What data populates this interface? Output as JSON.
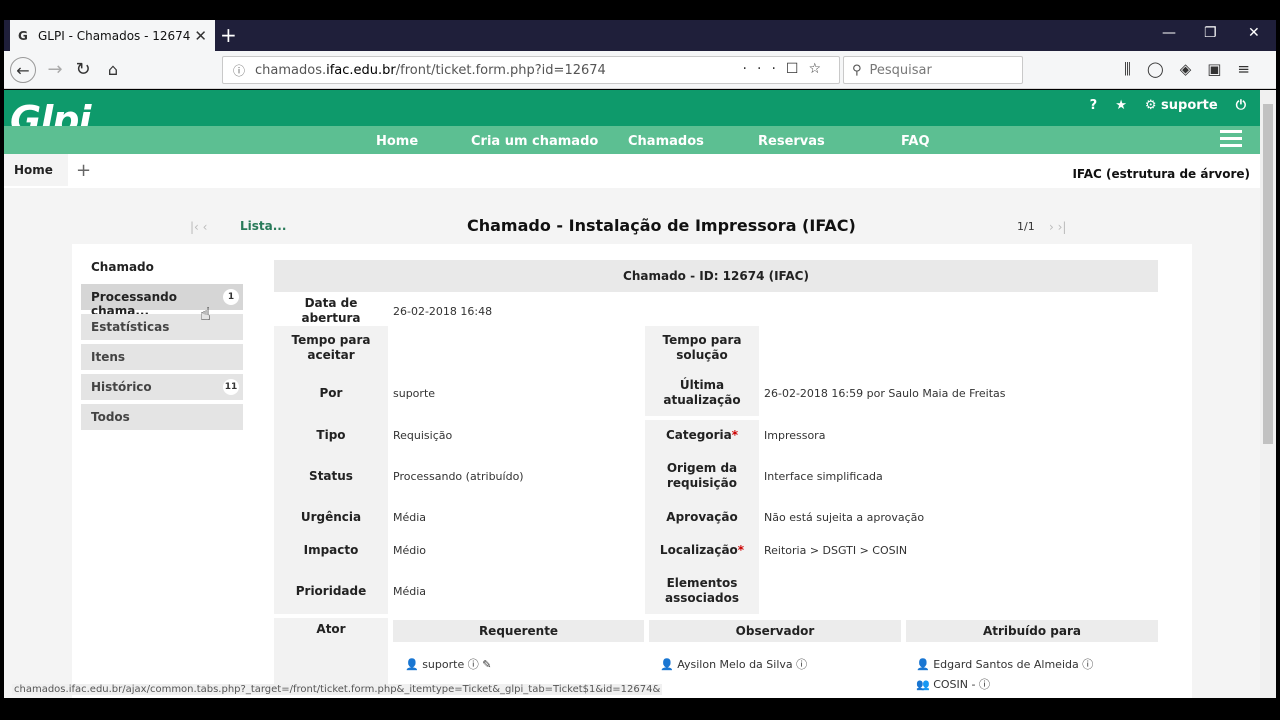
{
  "browser": {
    "tab_title": "GLPI - Chamados - 12674",
    "tab_favicon": "G",
    "url_prefix": "chamados.",
    "url_domain": "ifac.edu.br",
    "url_path": "/front/ticket.form.php?id=12674",
    "search_placeholder": "Pesquisar",
    "status_url": "chamados.ifac.edu.br/ajax/common.tabs.php?_target=/front/ticket.form.php&_itemtype=Ticket&_glpi_tab=Ticket$1&id=12674&"
  },
  "glpi": {
    "logo": "Glpi",
    "user": "suporte",
    "help": "?",
    "menu": [
      "Home",
      "Cria um chamado",
      "Chamados",
      "Reservas",
      "FAQ"
    ],
    "breadcrumb_home": "Home",
    "breadcrumb_plus": "+",
    "entity": "IFAC (estrutura de árvore)"
  },
  "page": {
    "list_link": "Lista...",
    "title": "Chamado - Instalação de Impressora (IFAC)",
    "counter": "1/1"
  },
  "sidebar": {
    "heading": "Chamado",
    "items": [
      {
        "label": "Processando chama...",
        "badge": "1"
      },
      {
        "label": "Estatísticas",
        "badge": ""
      },
      {
        "label": "Itens",
        "badge": ""
      },
      {
        "label": "Histórico",
        "badge": "11"
      },
      {
        "label": "Todos",
        "badge": ""
      }
    ]
  },
  "ticket": {
    "header": "Chamado - ID: 12674 (IFAC)",
    "fields": {
      "data_abertura_label": "Data de abertura",
      "data_abertura_value": "26-02-2018 16:48",
      "tempo_aceitar_label": "Tempo para aceitar",
      "tempo_solucao_label": "Tempo para solução",
      "por_label": "Por",
      "por_value": "suporte",
      "ultima_atualizacao_label": "Última atualização",
      "ultima_atualizacao_value": "26-02-2018 16:59 por Saulo Maia de Freitas",
      "tipo_label": "Tipo",
      "tipo_value": "Requisição",
      "categoria_label": "Categoria",
      "categoria_value": "Impressora",
      "status_label": "Status",
      "status_value": "Processando (atribuído)",
      "origem_label": "Origem da requisição",
      "origem_value": "Interface simplificada",
      "urgencia_label": "Urgência",
      "urgencia_value": "Média",
      "aprovacao_label": "Aprovação",
      "aprovacao_value": "Não está sujeita a aprovação",
      "impacto_label": "Impacto",
      "impacto_value": "Médio",
      "localizacao_label": "Localização",
      "localizacao_value": "Reitoria > DSGTI > COSIN",
      "prioridade_label": "Prioridade",
      "prioridade_value": "Média",
      "elementos_label": "Elementos associados",
      "required_mark": "*"
    },
    "actors": {
      "label": "Ator",
      "requerente_label": "Requerente",
      "observador_label": "Observador",
      "atribuido_label": "Atribuído para",
      "requerente": "suporte",
      "observador": "Aysilon Melo da Silva",
      "atribuido": "Edgard Santos de Almeida",
      "atribuido_group": "COSIN -"
    }
  },
  "colors": {
    "header_green": "#0e9a6b",
    "menu_green": "#5cbf92",
    "link_green": "#287a59"
  }
}
